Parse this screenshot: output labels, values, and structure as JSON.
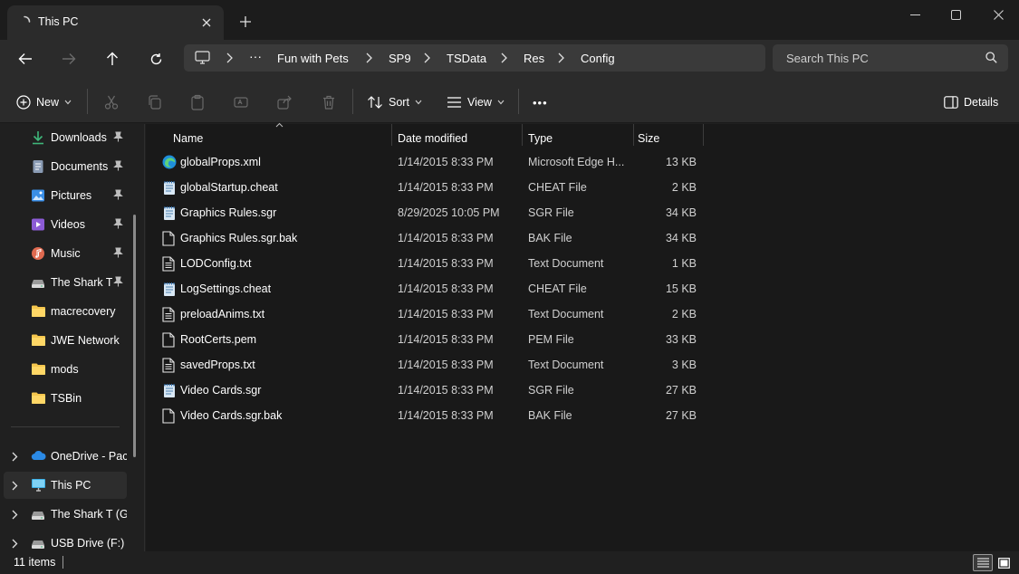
{
  "window": {
    "tab_title": "This PC",
    "new_tab_icon": "plus-icon",
    "controls": [
      "minimize",
      "maximize",
      "close"
    ]
  },
  "nav": {
    "back_icon": "arrow-left-icon",
    "forward_icon": "arrow-right-icon",
    "up_icon": "arrow-up-icon",
    "refresh_icon": "refresh-icon"
  },
  "breadcrumb": {
    "overflow": "···",
    "items": [
      "Fun with Pets",
      "SP9",
      "TSData",
      "Res",
      "Config"
    ]
  },
  "search": {
    "placeholder": "Search This PC"
  },
  "toolbar": {
    "new_label": "New",
    "sort_label": "Sort",
    "view_label": "View",
    "more_label": "•••",
    "details_label": "Details"
  },
  "sidebar": {
    "quick": [
      {
        "label": "Downloads",
        "icon": "download-icon",
        "pinned": true
      },
      {
        "label": "Documents",
        "icon": "documents-icon",
        "pinned": true
      },
      {
        "label": "Pictures",
        "icon": "pictures-icon",
        "pinned": true
      },
      {
        "label": "Videos",
        "icon": "videos-icon",
        "pinned": true
      },
      {
        "label": "Music",
        "icon": "music-icon",
        "pinned": true
      },
      {
        "label": "The Shark T (",
        "icon": "drive-icon",
        "pinned": true
      },
      {
        "label": "macrecovery",
        "icon": "folder-icon",
        "pinned": false
      },
      {
        "label": "JWE Network",
        "icon": "folder-icon",
        "pinned": false
      },
      {
        "label": "mods",
        "icon": "folder-icon",
        "pinned": false
      },
      {
        "label": "TSBin",
        "icon": "folder-icon",
        "pinned": false
      }
    ],
    "tree": [
      {
        "label": "OneDrive - Pace",
        "icon": "cloud-icon",
        "selected": false
      },
      {
        "label": "This PC",
        "icon": "monitor-icon",
        "selected": true
      },
      {
        "label": "The Shark T (G:)",
        "icon": "drive-icon",
        "selected": false
      },
      {
        "label": "USB Drive (F:)",
        "icon": "drive-icon",
        "selected": false
      }
    ]
  },
  "columns": {
    "name": "Name",
    "date": "Date modified",
    "type": "Type",
    "size": "Size"
  },
  "files": [
    {
      "name": "globalProps.xml",
      "date": "1/14/2015 8:33 PM",
      "type": "Microsoft Edge H...",
      "size": "13 KB",
      "icon": "edge-icon"
    },
    {
      "name": "globalStartup.cheat",
      "date": "1/14/2015 8:33 PM",
      "type": "CHEAT File",
      "size": "2 KB",
      "icon": "notepad-icon"
    },
    {
      "name": "Graphics Rules.sgr",
      "date": "8/29/2025 10:05 PM",
      "type": "SGR File",
      "size": "34 KB",
      "icon": "notepad-icon"
    },
    {
      "name": "Graphics Rules.sgr.bak",
      "date": "1/14/2015 8:33 PM",
      "type": "BAK File",
      "size": "34 KB",
      "icon": "file-icon"
    },
    {
      "name": "LODConfig.txt",
      "date": "1/14/2015 8:33 PM",
      "type": "Text Document",
      "size": "1 KB",
      "icon": "text-file-icon"
    },
    {
      "name": "LogSettings.cheat",
      "date": "1/14/2015 8:33 PM",
      "type": "CHEAT File",
      "size": "15 KB",
      "icon": "notepad-icon"
    },
    {
      "name": "preloadAnims.txt",
      "date": "1/14/2015 8:33 PM",
      "type": "Text Document",
      "size": "2 KB",
      "icon": "text-file-icon"
    },
    {
      "name": "RootCerts.pem",
      "date": "1/14/2015 8:33 PM",
      "type": "PEM File",
      "size": "33 KB",
      "icon": "file-icon"
    },
    {
      "name": "savedProps.txt",
      "date": "1/14/2015 8:33 PM",
      "type": "Text Document",
      "size": "3 KB",
      "icon": "text-file-icon"
    },
    {
      "name": "Video Cards.sgr",
      "date": "1/14/2015 8:33 PM",
      "type": "SGR File",
      "size": "27 KB",
      "icon": "notepad-icon"
    },
    {
      "name": "Video Cards.sgr.bak",
      "date": "1/14/2015 8:33 PM",
      "type": "BAK File",
      "size": "27 KB",
      "icon": "file-icon"
    }
  ],
  "status": {
    "count": "11 items"
  },
  "colors": {
    "accent": "#4cc2ff",
    "folder": "#f5c64d",
    "background": "#191919"
  }
}
